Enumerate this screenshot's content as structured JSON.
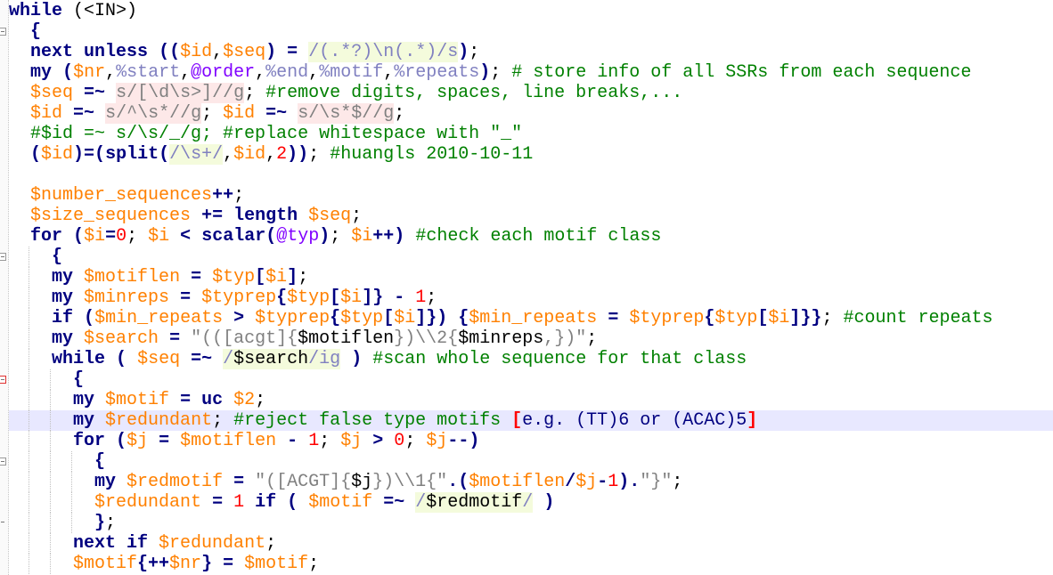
{
  "editor": {
    "language": "Perl",
    "highlighted_line": 20,
    "fold_markers": [
      {
        "line": 1,
        "type": "open"
      },
      {
        "line": 12,
        "type": "open"
      },
      {
        "line": 18,
        "type": "open-active"
      },
      {
        "line": 22,
        "type": "open"
      },
      {
        "line": 25,
        "type": "end"
      }
    ],
    "colors": {
      "keyword": "#000080",
      "variable": "#ff8000",
      "comment": "#008000",
      "regex": "#8080c0",
      "string": "#808080",
      "number": "#ff0000",
      "current_line": "#e8e8ff"
    },
    "lines": [
      {
        "indent": 0,
        "tokens": [
          [
            "k",
            "while"
          ],
          [
            "p",
            " (<IN>)"
          ]
        ]
      },
      {
        "indent": 1,
        "tokens": [
          [
            "o",
            "{"
          ]
        ]
      },
      {
        "indent": 1,
        "tokens": [
          [
            "k",
            "next unless"
          ],
          [
            "p",
            " "
          ],
          [
            "o",
            "(("
          ],
          [
            "v",
            "$id"
          ],
          [
            "p",
            ","
          ],
          [
            "v",
            "$seq"
          ],
          [
            "o",
            ")"
          ],
          [
            "p",
            " "
          ],
          [
            "o",
            "="
          ],
          [
            "p",
            " "
          ],
          [
            "r",
            "/(.*?)\\n(.*)/s"
          ],
          [
            "o",
            ")"
          ],
          [
            "p",
            ";"
          ]
        ]
      },
      {
        "indent": 1,
        "tokens": [
          [
            "k",
            "my"
          ],
          [
            "p",
            " "
          ],
          [
            "o",
            "("
          ],
          [
            "v",
            "$nr"
          ],
          [
            "p",
            ","
          ],
          [
            "h",
            "%start"
          ],
          [
            "p",
            ","
          ],
          [
            "a",
            "@order"
          ],
          [
            "p",
            ","
          ],
          [
            "h",
            "%end"
          ],
          [
            "p",
            ","
          ],
          [
            "h",
            "%motif"
          ],
          [
            "p",
            ","
          ],
          [
            "h",
            "%repeats"
          ],
          [
            "o",
            ")"
          ],
          [
            "p",
            "; "
          ],
          [
            "c",
            "# store info of all SSRs from each sequence"
          ]
        ]
      },
      {
        "indent": 1,
        "tokens": [
          [
            "v",
            "$seq"
          ],
          [
            "p",
            " "
          ],
          [
            "o",
            "=~"
          ],
          [
            "p",
            " "
          ],
          [
            "s",
            "s/[\\d\\s>]//g"
          ],
          [
            "p",
            "; "
          ],
          [
            "c",
            "#remove digits, spaces, line breaks,..."
          ]
        ]
      },
      {
        "indent": 1,
        "tokens": [
          [
            "v",
            "$id"
          ],
          [
            "p",
            " "
          ],
          [
            "o",
            "=~"
          ],
          [
            "p",
            " "
          ],
          [
            "s",
            "s/^\\s*//g"
          ],
          [
            "p",
            "; "
          ],
          [
            "v",
            "$id"
          ],
          [
            "p",
            " "
          ],
          [
            "o",
            "=~"
          ],
          [
            "p",
            " "
          ],
          [
            "s",
            "s/\\s*$//g"
          ],
          [
            "p",
            ";"
          ]
        ]
      },
      {
        "indent": 1,
        "tokens": [
          [
            "c",
            "#$id =~ s/\\s/_/g; #replace whitespace with \"_\""
          ]
        ]
      },
      {
        "indent": 1,
        "tokens": [
          [
            "o",
            "("
          ],
          [
            "v",
            "$id"
          ],
          [
            "o",
            ")=("
          ],
          [
            "k",
            "split"
          ],
          [
            "o",
            "("
          ],
          [
            "r",
            "/\\s+/"
          ],
          [
            "p",
            ","
          ],
          [
            "v",
            "$id"
          ],
          [
            "p",
            ","
          ],
          [
            "n",
            "2"
          ],
          [
            "o",
            "))"
          ],
          [
            "p",
            "; "
          ],
          [
            "c",
            "#huangls 2010-10-11"
          ]
        ]
      },
      {
        "indent": 1,
        "tokens": []
      },
      {
        "indent": 1,
        "tokens": [
          [
            "v",
            "$number_sequences"
          ],
          [
            "o",
            "++"
          ],
          [
            "p",
            ";"
          ]
        ]
      },
      {
        "indent": 1,
        "tokens": [
          [
            "v",
            "$size_sequences"
          ],
          [
            "p",
            " "
          ],
          [
            "o",
            "+="
          ],
          [
            "p",
            " "
          ],
          [
            "k",
            "length"
          ],
          [
            "p",
            " "
          ],
          [
            "v",
            "$seq"
          ],
          [
            "p",
            ";"
          ]
        ]
      },
      {
        "indent": 1,
        "tokens": [
          [
            "k",
            "for"
          ],
          [
            "p",
            " "
          ],
          [
            "o",
            "("
          ],
          [
            "v",
            "$i"
          ],
          [
            "o",
            "="
          ],
          [
            "n",
            "0"
          ],
          [
            "p",
            "; "
          ],
          [
            "v",
            "$i"
          ],
          [
            "p",
            " "
          ],
          [
            "o",
            "<"
          ],
          [
            "p",
            " "
          ],
          [
            "k",
            "scalar"
          ],
          [
            "o",
            "("
          ],
          [
            "a",
            "@typ"
          ],
          [
            "o",
            ")"
          ],
          [
            "p",
            "; "
          ],
          [
            "v",
            "$i"
          ],
          [
            "o",
            "++)"
          ],
          [
            "p",
            " "
          ],
          [
            "c",
            "#check each motif class"
          ]
        ]
      },
      {
        "indent": 2,
        "tokens": [
          [
            "o",
            "{"
          ]
        ]
      },
      {
        "indent": 2,
        "tokens": [
          [
            "k",
            "my"
          ],
          [
            "p",
            " "
          ],
          [
            "v",
            "$motiflen"
          ],
          [
            "p",
            " "
          ],
          [
            "o",
            "="
          ],
          [
            "p",
            " "
          ],
          [
            "v",
            "$typ"
          ],
          [
            "o",
            "["
          ],
          [
            "v",
            "$i"
          ],
          [
            "o",
            "]"
          ],
          [
            "p",
            ";"
          ]
        ]
      },
      {
        "indent": 2,
        "tokens": [
          [
            "k",
            "my"
          ],
          [
            "p",
            " "
          ],
          [
            "v",
            "$minreps"
          ],
          [
            "p",
            " "
          ],
          [
            "o",
            "="
          ],
          [
            "p",
            " "
          ],
          [
            "v",
            "$typrep"
          ],
          [
            "o",
            "{"
          ],
          [
            "v",
            "$typ"
          ],
          [
            "o",
            "["
          ],
          [
            "v",
            "$i"
          ],
          [
            "o",
            "]}"
          ],
          [
            "p",
            " "
          ],
          [
            "o",
            "-"
          ],
          [
            "p",
            " "
          ],
          [
            "n",
            "1"
          ],
          [
            "p",
            ";"
          ]
        ]
      },
      {
        "indent": 2,
        "tokens": [
          [
            "k",
            "if"
          ],
          [
            "p",
            " "
          ],
          [
            "o",
            "("
          ],
          [
            "v",
            "$min_repeats"
          ],
          [
            "p",
            " "
          ],
          [
            "o",
            ">"
          ],
          [
            "p",
            " "
          ],
          [
            "v",
            "$typrep"
          ],
          [
            "o",
            "{"
          ],
          [
            "v",
            "$typ"
          ],
          [
            "o",
            "["
          ],
          [
            "v",
            "$i"
          ],
          [
            "o",
            "]})"
          ],
          [
            "p",
            " "
          ],
          [
            "o",
            "{"
          ],
          [
            "v",
            "$min_repeats"
          ],
          [
            "p",
            " "
          ],
          [
            "o",
            "="
          ],
          [
            "p",
            " "
          ],
          [
            "v",
            "$typrep"
          ],
          [
            "o",
            "{"
          ],
          [
            "v",
            "$typ"
          ],
          [
            "o",
            "["
          ],
          [
            "v",
            "$i"
          ],
          [
            "o",
            "]}}"
          ],
          [
            "p",
            "; "
          ],
          [
            "c",
            "#count repeats"
          ]
        ]
      },
      {
        "indent": 2,
        "tokens": [
          [
            "k",
            "my"
          ],
          [
            "p",
            " "
          ],
          [
            "v",
            "$search"
          ],
          [
            "p",
            " "
          ],
          [
            "o",
            "="
          ],
          [
            "p",
            " "
          ],
          [
            "q",
            "\"(([acgt]{"
          ],
          [
            "qv",
            "$motiflen"
          ],
          [
            "q",
            "})\\\\2{"
          ],
          [
            "qv",
            "$minreps"
          ],
          [
            "q",
            ",})\""
          ],
          [
            "p",
            ";"
          ]
        ]
      },
      {
        "indent": 2,
        "tokens": [
          [
            "k",
            "while"
          ],
          [
            "p",
            " "
          ],
          [
            "o",
            "("
          ],
          [
            "p",
            " "
          ],
          [
            "v",
            "$seq"
          ],
          [
            "p",
            " "
          ],
          [
            "o",
            "=~"
          ],
          [
            "p",
            " "
          ],
          [
            "r",
            "/"
          ],
          [
            "rv",
            "$search"
          ],
          [
            "r",
            "/ig"
          ],
          [
            "p",
            " "
          ],
          [
            "o",
            ")"
          ],
          [
            "p",
            " "
          ],
          [
            "c",
            "#scan whole sequence for that class"
          ]
        ]
      },
      {
        "indent": 3,
        "tokens": [
          [
            "o",
            "{"
          ]
        ]
      },
      {
        "indent": 3,
        "tokens": [
          [
            "k",
            "my"
          ],
          [
            "p",
            " "
          ],
          [
            "v",
            "$motif"
          ],
          [
            "p",
            " "
          ],
          [
            "o",
            "="
          ],
          [
            "p",
            " "
          ],
          [
            "k",
            "uc"
          ],
          [
            "p",
            " "
          ],
          [
            "v",
            "$2"
          ],
          [
            "p",
            ";"
          ]
        ]
      },
      {
        "indent": 3,
        "tokens": [
          [
            "k",
            "my"
          ],
          [
            "p",
            " "
          ],
          [
            "v",
            "$redundant"
          ],
          [
            "p",
            "; "
          ],
          [
            "c",
            "#reject false type motifs "
          ],
          [
            "e",
            "["
          ],
          [
            "b",
            "e.g. (TT)6 or (ACAC)5"
          ],
          [
            "e",
            "]"
          ]
        ]
      },
      {
        "indent": 3,
        "tokens": [
          [
            "k",
            "for"
          ],
          [
            "p",
            " "
          ],
          [
            "o",
            "("
          ],
          [
            "v",
            "$j"
          ],
          [
            "p",
            " "
          ],
          [
            "o",
            "="
          ],
          [
            "p",
            " "
          ],
          [
            "v",
            "$motiflen"
          ],
          [
            "p",
            " "
          ],
          [
            "o",
            "-"
          ],
          [
            "p",
            " "
          ],
          [
            "n",
            "1"
          ],
          [
            "p",
            "; "
          ],
          [
            "v",
            "$j"
          ],
          [
            "p",
            " "
          ],
          [
            "o",
            ">"
          ],
          [
            "p",
            " "
          ],
          [
            "n",
            "0"
          ],
          [
            "p",
            "; "
          ],
          [
            "v",
            "$j"
          ],
          [
            "o",
            "--)"
          ]
        ]
      },
      {
        "indent": 4,
        "tokens": [
          [
            "o",
            "{"
          ]
        ]
      },
      {
        "indent": 4,
        "tokens": [
          [
            "k",
            "my"
          ],
          [
            "p",
            " "
          ],
          [
            "v",
            "$redmotif"
          ],
          [
            "p",
            " "
          ],
          [
            "o",
            "="
          ],
          [
            "p",
            " "
          ],
          [
            "q",
            "\"([ACGT]{"
          ],
          [
            "qv",
            "$j"
          ],
          [
            "q",
            "})\\\\1{\""
          ],
          [
            "o",
            ".("
          ],
          [
            "v",
            "$motiflen"
          ],
          [
            "o",
            "/"
          ],
          [
            "v",
            "$j"
          ],
          [
            "o",
            "-"
          ],
          [
            "n",
            "1"
          ],
          [
            "o",
            ")."
          ],
          [
            "q",
            "\"}\""
          ],
          [
            "p",
            ";"
          ]
        ]
      },
      {
        "indent": 4,
        "tokens": [
          [
            "v",
            "$redundant"
          ],
          [
            "p",
            " "
          ],
          [
            "o",
            "="
          ],
          [
            "p",
            " "
          ],
          [
            "n",
            "1"
          ],
          [
            "p",
            " "
          ],
          [
            "k",
            "if"
          ],
          [
            "p",
            " "
          ],
          [
            "o",
            "("
          ],
          [
            "p",
            " "
          ],
          [
            "v",
            "$motif"
          ],
          [
            "p",
            " "
          ],
          [
            "o",
            "=~"
          ],
          [
            "p",
            " "
          ],
          [
            "r",
            "/"
          ],
          [
            "rv",
            "$redmotif"
          ],
          [
            "r",
            "/"
          ],
          [
            "p",
            " "
          ],
          [
            "o",
            ")"
          ]
        ]
      },
      {
        "indent": 4,
        "tokens": [
          [
            "o",
            "}"
          ],
          [
            "p",
            ";"
          ]
        ]
      },
      {
        "indent": 3,
        "tokens": [
          [
            "k",
            "next if"
          ],
          [
            "p",
            " "
          ],
          [
            "v",
            "$redundant"
          ],
          [
            "p",
            ";"
          ]
        ]
      },
      {
        "indent": 3,
        "tokens": [
          [
            "v",
            "$motif"
          ],
          [
            "o",
            "{++"
          ],
          [
            "v",
            "$nr"
          ],
          [
            "o",
            "}"
          ],
          [
            "p",
            " "
          ],
          [
            "o",
            "="
          ],
          [
            "p",
            " "
          ],
          [
            "v",
            "$motif"
          ],
          [
            "p",
            ";"
          ]
        ]
      }
    ]
  }
}
